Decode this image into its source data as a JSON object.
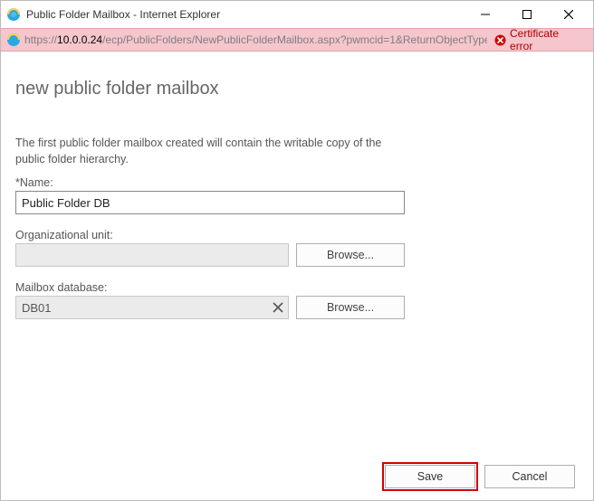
{
  "window": {
    "title": "Public Folder Mailbox - Internet Explorer"
  },
  "addressbar": {
    "url_prefix": "https://",
    "url_host": "10.0.0.24",
    "url_path": "/ecp/PublicFolders/NewPublicFolderMailbox.aspx?pwmcid=1&ReturnObjectType",
    "cert_error": "Certificate error"
  },
  "page": {
    "title": "new public folder mailbox",
    "intro": "The first public folder mailbox created will contain the writable copy of the public folder hierarchy.",
    "name_label": "*Name:",
    "name_value": "Public Folder DB",
    "ou_label": "Organizational unit:",
    "ou_value": "",
    "ou_browse": "Browse...",
    "mbdb_label": "Mailbox database:",
    "mbdb_value": "DB01",
    "mbdb_browse": "Browse..."
  },
  "footer": {
    "save": "Save",
    "cancel": "Cancel"
  }
}
